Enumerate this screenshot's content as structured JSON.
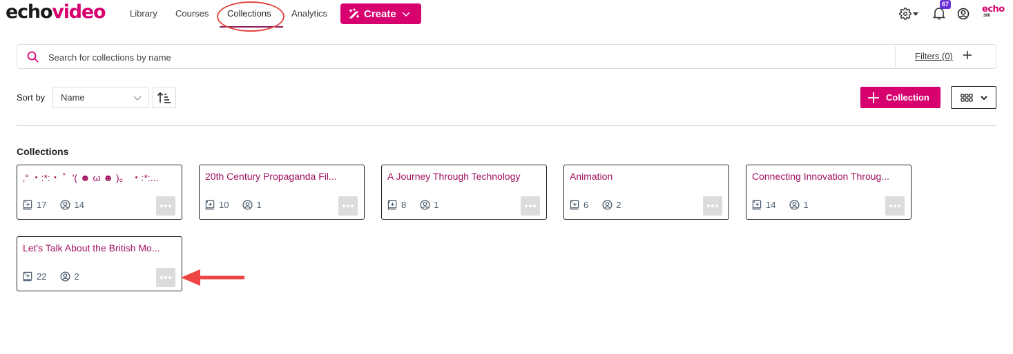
{
  "brand": {
    "logo_part1": "echo",
    "logo_part2": "video",
    "accent_color": "#d6006f",
    "echo360_top": "echo",
    "echo360_bottom": "360"
  },
  "nav": {
    "items": [
      {
        "label": "Library",
        "active": false
      },
      {
        "label": "Courses",
        "active": false
      },
      {
        "label": "Collections",
        "active": true
      },
      {
        "label": "Analytics",
        "active": false
      }
    ],
    "create_label": "Create",
    "notifications_count": "67",
    "icons": [
      "settings-gear-icon",
      "notification-bell-icon",
      "user-account-icon"
    ]
  },
  "search": {
    "placeholder": "Search for collections by name",
    "value": "",
    "filters_label": "Filters (0)"
  },
  "sort": {
    "label": "Sort by",
    "selected": "Name",
    "direction": "ascending"
  },
  "actions": {
    "add_collection_label": "Collection",
    "view_mode": "grid"
  },
  "section": {
    "title": "Collections"
  },
  "collections": [
    {
      "title": "ˏˋ°•*⁀➷ .｡ ･:*:･ ﾟ’( ☻ ω ☻ )｡ ･:*:･...",
      "title_display": "‚°   ・:*:・  ゜'( ☻ ω ☻ )。  ・:*:...",
      "media_count": "17",
      "member_count": "14"
    },
    {
      "title": "20th Century Propaganda Fil...",
      "media_count": "10",
      "member_count": "1"
    },
    {
      "title": "A Journey Through Technology",
      "media_count": "8",
      "member_count": "1"
    },
    {
      "title": "Animation",
      "media_count": "6",
      "member_count": "2"
    },
    {
      "title": "Connecting Innovation Throug...",
      "media_count": "14",
      "member_count": "1"
    },
    {
      "title": "Let's Talk About the British Mo...",
      "media_count": "22",
      "member_count": "2"
    }
  ],
  "annotations": {
    "highlight_color": "#e4473f"
  }
}
